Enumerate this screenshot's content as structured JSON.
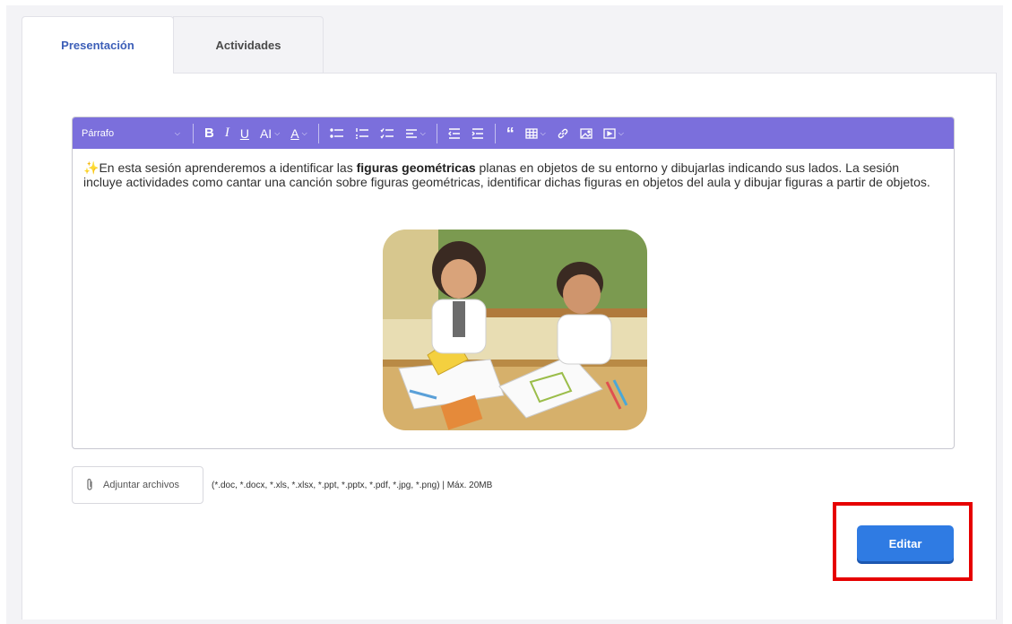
{
  "tabs": [
    {
      "label": "Presentación",
      "active": true
    },
    {
      "label": "Actividades",
      "active": false
    }
  ],
  "toolbar": {
    "paragraph_select": "Párrafo",
    "bold": "B",
    "italic": "I",
    "underline": "U",
    "font_size": "AI",
    "font_color": "A",
    "accent_color": "#7b6fdc"
  },
  "content": {
    "spark_icon": "✨",
    "text_before": "En esta sesión aprenderemos a identificar las ",
    "bold_text": "figuras geométricas",
    "text_after": " planas en objetos de su entorno y dibujarlas indicando sus lados. La sesión incluye actividades como cantar una canción sobre figuras geométricas, identificar dichas figuras en objetos del aula y dibujar figuras a partir de objetos."
  },
  "attach": {
    "label": "Adjuntar archivos",
    "formats": "(*.doc, *.docx, *.xls, *.xlsx, *.ppt, *.pptx, *.pdf, *.jpg, *.png) | Máx. 20MB"
  },
  "actions": {
    "edit_label": "Editar",
    "edit_color": "#2f7be3",
    "highlight_color": "#e60000"
  }
}
